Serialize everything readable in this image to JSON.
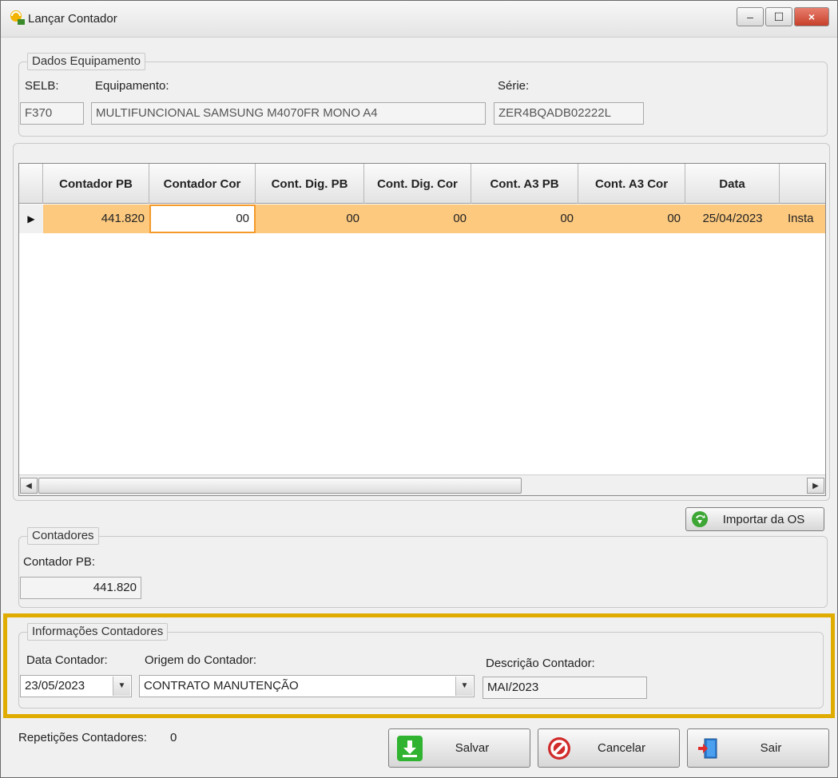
{
  "window": {
    "title": "Lançar Contador",
    "icon": "app-logo-icon",
    "minimize_icon": "–",
    "maximize_icon": "☐",
    "close_icon": "×"
  },
  "equipment": {
    "legend": "Dados Equipamento",
    "selb_label": "SELB:",
    "selb_value": "F370",
    "equip_label": "Equipamento:",
    "equip_value": "MULTIFUNCIONAL SAMSUNG M4070FR MONO A4",
    "serie_label": "Série:",
    "serie_value": "ZER4BQADB02222L"
  },
  "grid": {
    "columns": [
      "Contador PB",
      "Contador Cor",
      "Cont. Dig. PB",
      "Cont. Dig. Cor",
      "Cont. A3 PB",
      "Cont. A3 Cor",
      "Data",
      ""
    ],
    "rows": [
      {
        "indicator": "▶",
        "cells": [
          "441.820",
          "00",
          "00",
          "00",
          "00",
          "00",
          "25/04/2023",
          "Insta"
        ]
      }
    ],
    "scroll_left": "◀",
    "scroll_right": "▶"
  },
  "import_button": {
    "label": "Importar da OS",
    "icon": "import-arrow-icon"
  },
  "counters": {
    "legend": "Contadores",
    "pb_label": "Contador PB:",
    "pb_value": "441.820"
  },
  "info": {
    "legend": "Informações Contadores",
    "date_label": "Data Contador:",
    "date_value": "23/05/2023",
    "origin_label": "Origem do Contador:",
    "origin_value": "CONTRATO MANUTENÇÃO",
    "desc_label": "Descrição Contador:",
    "desc_value": "MAI/2023",
    "dropdown_icon": "▼"
  },
  "footer": {
    "repeat_label": "Repetições Contadores:",
    "repeat_value": "0",
    "save_label": "Salvar",
    "cancel_label": "Cancelar",
    "exit_label": "Sair"
  },
  "colors": {
    "selected_row": "#fcc97f",
    "highlight_border": "#e0ac00",
    "edit_cell_border": "#f59a2a"
  }
}
